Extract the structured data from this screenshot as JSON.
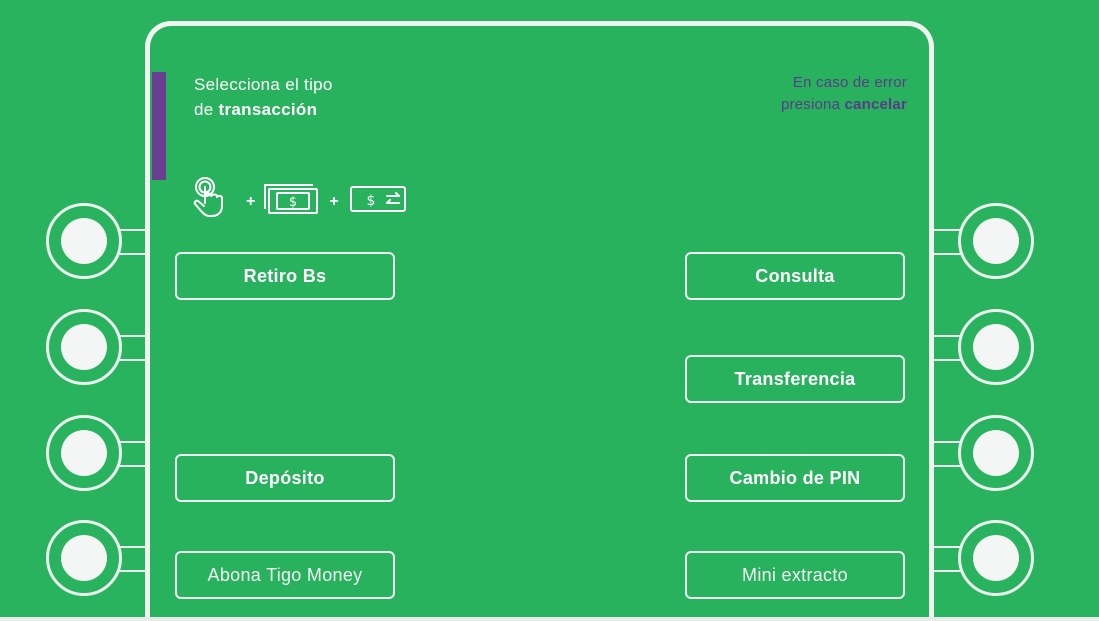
{
  "screen": {
    "title_line1": "Selecciona el tipo",
    "title_line2_prefix": "de ",
    "title_line2_bold": "transacción",
    "error_line1": "En caso de error",
    "error_line2_prefix": "presiona ",
    "error_line2_bold": "cancelar"
  },
  "steps": {
    "icons": [
      "touch-icon",
      "banknote-icon",
      "money-transfer-icon"
    ],
    "separator": "+",
    "currency_symbol": "$"
  },
  "menu": {
    "left": [
      {
        "label": "Retiro Bs"
      },
      {
        "label": "Depósito"
      },
      {
        "label": "Abona Tigo Money"
      }
    ],
    "right": [
      {
        "label": "Consulta"
      },
      {
        "label": "Transferencia"
      },
      {
        "label": "Cambio de PIN"
      },
      {
        "label": "Mini extracto"
      }
    ]
  },
  "colors": {
    "background": "#2ab35f",
    "accent_purple": "#6a3f91",
    "text_purple": "#5a3b8a",
    "outline": "#eef6f1"
  }
}
